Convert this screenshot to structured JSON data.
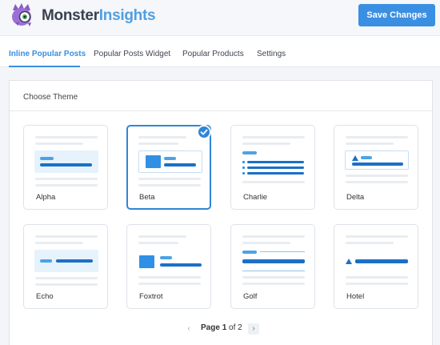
{
  "header": {
    "brand_part1": "Monster",
    "brand_part2": "Insights",
    "save_label": "Save Changes",
    "accent": "#3a8fe2"
  },
  "tabs": [
    {
      "label": "Inline Popular Posts",
      "active": true
    },
    {
      "label": "Popular Posts Widget",
      "active": false
    },
    {
      "label": "Popular Products",
      "active": false
    },
    {
      "label": "Settings",
      "active": false
    }
  ],
  "panel": {
    "title": "Choose Theme"
  },
  "themes": [
    {
      "name": "Alpha",
      "selected": false
    },
    {
      "name": "Beta",
      "selected": true
    },
    {
      "name": "Charlie",
      "selected": false
    },
    {
      "name": "Delta",
      "selected": false
    },
    {
      "name": "Echo",
      "selected": false
    },
    {
      "name": "Foxtrot",
      "selected": false
    },
    {
      "name": "Golf",
      "selected": false
    },
    {
      "name": "Hotel",
      "selected": false
    }
  ],
  "pagination": {
    "page_word": "Page",
    "current": "1",
    "of_word": "of",
    "total": "2",
    "prev_icon": "chevron-left-icon",
    "next_icon": "chevron-right-icon"
  }
}
